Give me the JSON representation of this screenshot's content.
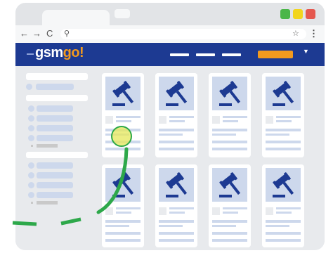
{
  "app": {
    "logo_prefix": "gsm",
    "logo_suffix": "go!"
  },
  "toolbar": {
    "back_icon": "←",
    "forward_icon": "→",
    "reload_icon": "C",
    "search_icon": "⚲",
    "star_icon": "☆",
    "menu_icon": "⋮"
  },
  "colors": {
    "header_bg": "#1d3a92",
    "accent": "#f39a1e",
    "placeholder": "#cdd8ec",
    "highlight_ring": "#2da84a",
    "window_min": "#4bb649",
    "window_max": "#f2d51e",
    "window_close": "#e5584f"
  },
  "listing": {
    "item_icon": "gavel-icon",
    "rows": 2,
    "columns": 4
  }
}
